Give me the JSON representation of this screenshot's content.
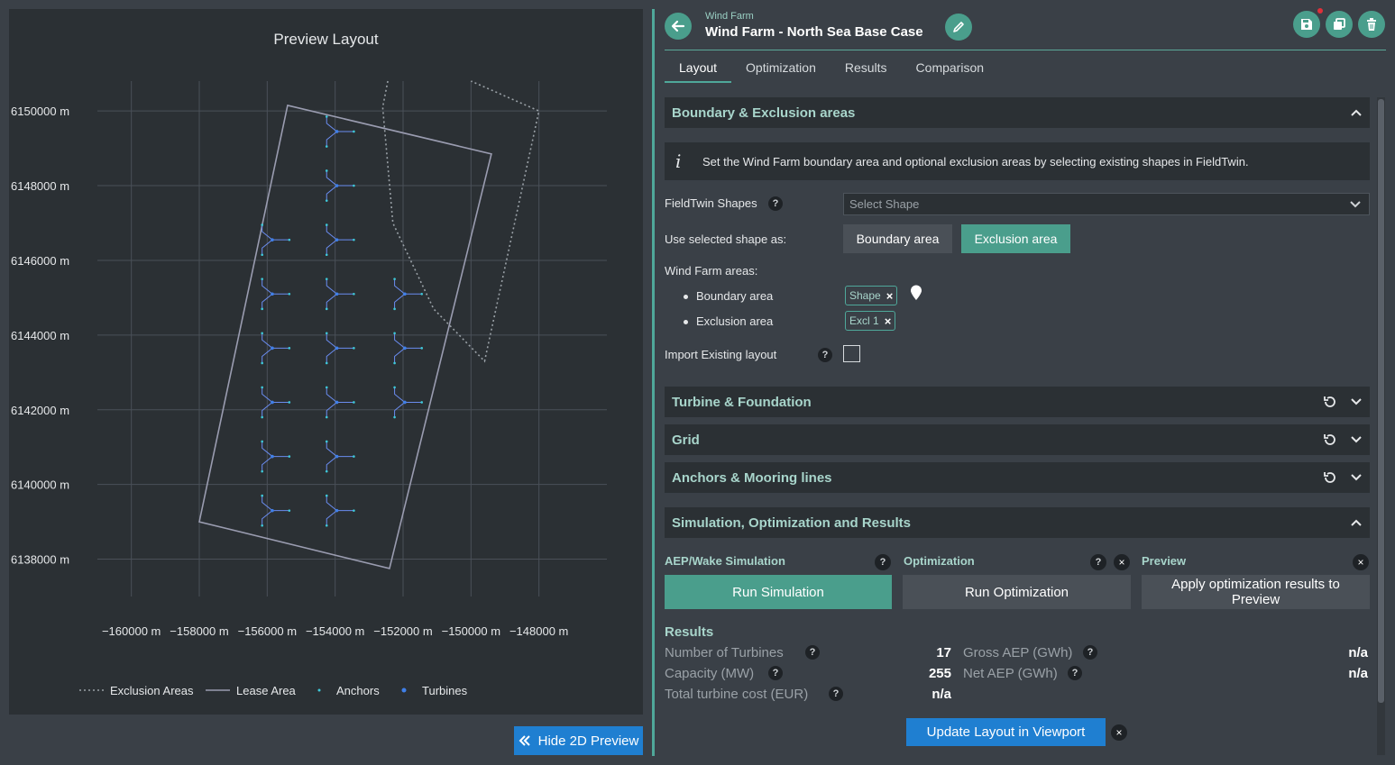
{
  "preview": {
    "title": "Preview Layout",
    "hide_button_label": "Hide 2D Preview"
  },
  "chart_data": {
    "type": "scatter",
    "title": "Preview Layout",
    "xlim": [
      -161000,
      -146000
    ],
    "ylim": [
      6137000,
      6150800
    ],
    "x_ticks": [
      -160000,
      -158000,
      -156000,
      -154000,
      -152000,
      -150000,
      -148000
    ],
    "x_tick_labels": [
      "−160000 m",
      "−158000 m",
      "−156000 m",
      "−154000 m",
      "−152000 m",
      "−150000 m",
      "−148000 m"
    ],
    "y_ticks": [
      6138000,
      6140000,
      6142000,
      6144000,
      6146000,
      6148000,
      6150000
    ],
    "y_tick_labels": [
      "6138000 m",
      "6140000 m",
      "6142000 m",
      "6144000 m",
      "6146000 m",
      "6148000 m",
      "6150000 m"
    ],
    "grid": true,
    "legend_position": "bottom",
    "legend": [
      "Exclusion Areas",
      "Lease Area",
      "Anchors",
      "Turbines"
    ],
    "colors": {
      "exclusion": "#9aa1a7",
      "lease": "#9a9cb0",
      "anchors": "#3ec8d8",
      "turbines": "#3f7fe8",
      "mooring": "#6a8cf0",
      "grid": "#4a5058"
    },
    "lease_area": [
      [
        -155400,
        6150150
      ],
      [
        -149400,
        6148850
      ],
      [
        -152400,
        6137750
      ],
      [
        -158000,
        6139000
      ]
    ],
    "exclusion_area": [
      [
        -152450,
        6150800
      ],
      [
        -152600,
        6150100
      ],
      [
        -152300,
        6147000
      ],
      [
        -151100,
        6144700
      ],
      [
        -149600,
        6143300
      ],
      [
        -148000,
        6150000
      ],
      [
        -150000,
        6150800
      ]
    ],
    "turbines": [
      {
        "x": -153950,
        "y": 6149450
      },
      {
        "x": -153950,
        "y": 6148000
      },
      {
        "x": -155850,
        "y": 6146550
      },
      {
        "x": -153950,
        "y": 6146550
      },
      {
        "x": -155850,
        "y": 6145100
      },
      {
        "x": -153950,
        "y": 6145100
      },
      {
        "x": -151950,
        "y": 6145100
      },
      {
        "x": -155850,
        "y": 6143650
      },
      {
        "x": -153950,
        "y": 6143650
      },
      {
        "x": -151950,
        "y": 6143650
      },
      {
        "x": -155850,
        "y": 6142200
      },
      {
        "x": -153950,
        "y": 6142200
      },
      {
        "x": -151950,
        "y": 6142200
      },
      {
        "x": -155850,
        "y": 6140750
      },
      {
        "x": -153950,
        "y": 6140750
      },
      {
        "x": -155850,
        "y": 6139300
      },
      {
        "x": -153950,
        "y": 6139300
      }
    ],
    "anchor_offsets": [
      [
        -300,
        400
      ],
      [
        -300,
        -400
      ],
      [
        500,
        0
      ]
    ]
  },
  "header": {
    "subtitle": "Wind Farm",
    "title": "Wind Farm - North Sea Base Case"
  },
  "tabs": [
    {
      "label": "Layout"
    },
    {
      "label": "Optimization"
    },
    {
      "label": "Results"
    },
    {
      "label": "Comparison"
    }
  ],
  "boundary": {
    "section_title": "Boundary & Exclusion areas",
    "info_text": "Set the Wind Farm boundary area and optional exclusion areas by selecting existing shapes in FieldTwin.",
    "shapes_label": "FieldTwin Shapes",
    "select_placeholder": "Select Shape",
    "use_as_label": "Use selected shape as:",
    "boundary_button": "Boundary area",
    "exclusion_button": "Exclusion area",
    "areas_label": "Wind Farm areas:",
    "boundary_item": "Boundary area",
    "boundary_chip": "Shape",
    "exclusion_item": "Exclusion area",
    "exclusion_chip": "Excl 1",
    "import_label": "Import Existing layout"
  },
  "sections": {
    "turbine": "Turbine & Foundation",
    "grid": "Grid",
    "anchors": "Anchors & Mooring lines",
    "simulation": "Simulation, Optimization and Results"
  },
  "simulation": {
    "aep_title": "AEP/Wake Simulation",
    "optimization_title": "Optimization",
    "preview_title": "Preview",
    "run_simulation": "Run Simulation",
    "run_optimization": "Run Optimization",
    "apply_results": "Apply optimization results to Preview"
  },
  "results": {
    "title": "Results",
    "num_turbines_label": "Number of Turbines",
    "num_turbines_value": "17",
    "capacity_label": "Capacity (MW)",
    "capacity_value": "255",
    "turbine_cost_label": "Total turbine cost (EUR)",
    "turbine_cost_value": "n/a",
    "gross_aep_label": "Gross AEP (GWh)",
    "gross_aep_value": "n/a",
    "net_aep_label": "Net AEP (GWh)",
    "net_aep_value": "n/a"
  },
  "update_button": "Update Layout in Viewport",
  "help_glyph": "?",
  "close_glyph": "×"
}
